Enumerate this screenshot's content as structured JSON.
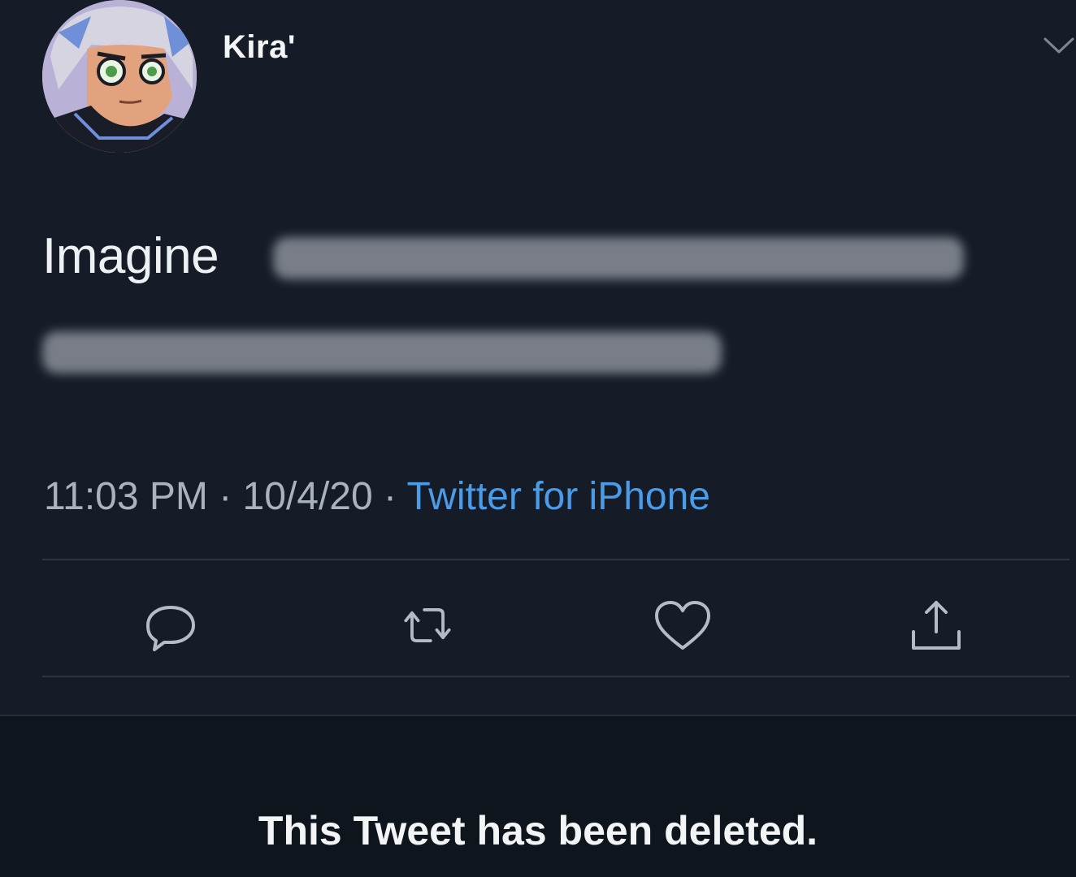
{
  "tweet": {
    "display_name": "Kira'",
    "text": "Imagine",
    "time": "11:03 PM",
    "date": "10/4/20",
    "separator": " · ",
    "source": "Twitter for iPhone"
  },
  "actions": {
    "reply_icon": "reply-icon",
    "retweet_icon": "retweet-icon",
    "like_icon": "heart-icon",
    "share_icon": "share-icon"
  },
  "notice": {
    "text": "This Tweet has been deleted."
  },
  "colors": {
    "background": "#151c27",
    "text": "#eef1f3",
    "meta": "#a9b3bd",
    "link": "#4a9be8",
    "notice_background": "#0f151d"
  }
}
